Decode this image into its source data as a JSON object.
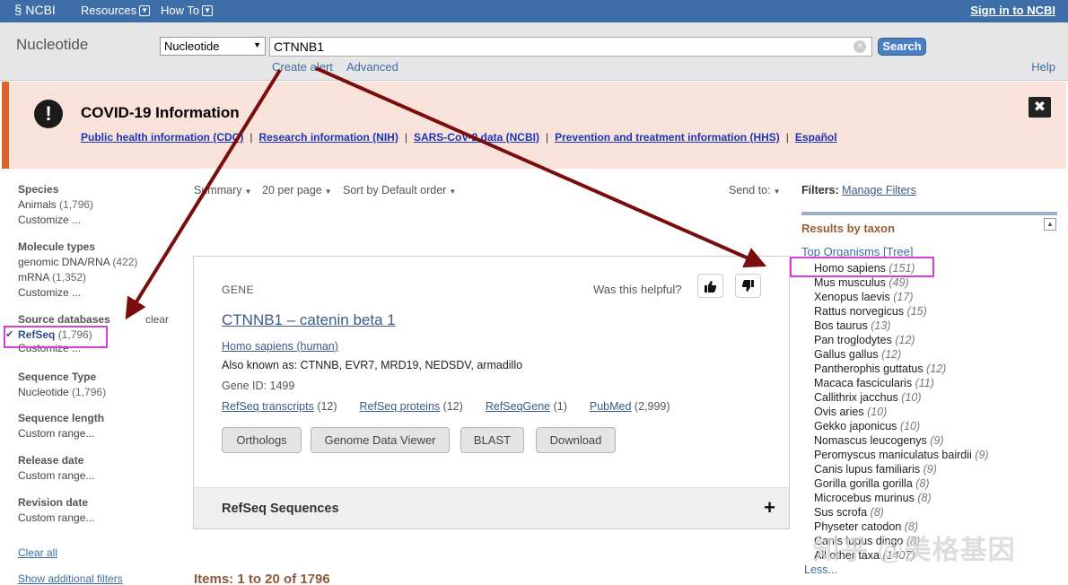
{
  "topbar": {
    "logo": "NCBI",
    "resources": "Resources",
    "howto": "How To",
    "signin": "Sign in to NCBI"
  },
  "search": {
    "db_title": "Nucleotide",
    "db_select": "Nucleotide",
    "term": "CTNNB1",
    "button": "Search",
    "create_alert": "Create alert",
    "advanced": "Advanced",
    "help": "Help"
  },
  "covid": {
    "title": "COVID-19 Information",
    "links": [
      "Public health information (CDC)",
      "Research information (NIH)",
      "SARS-CoV-2 data (NCBI)",
      "Prevention and treatment information (HHS)",
      "Español"
    ]
  },
  "facets": {
    "species": {
      "title": "Species",
      "items": [
        "Animals"
      ],
      "counts": [
        "(1,796)"
      ],
      "customize": "Customize ..."
    },
    "molecule": {
      "title": "Molecule types",
      "items": [
        "genomic DNA/RNA",
        "mRNA"
      ],
      "counts": [
        "(422)",
        "(1,352)"
      ],
      "customize": "Customize ..."
    },
    "source": {
      "title": "Source databases",
      "clear": "clear",
      "item": "RefSeq",
      "count": "(1,796)",
      "customize": "Customize ..."
    },
    "seqtype": {
      "title": "Sequence Type",
      "item": "Nucleotide",
      "count": "(1,796)"
    },
    "seqlen": {
      "title": "Sequence length",
      "item": "Custom range..."
    },
    "release": {
      "title": "Release date",
      "item": "Custom range..."
    },
    "revision": {
      "title": "Revision date",
      "item": "Custom range..."
    },
    "clear_all": "Clear all",
    "show_additional": "Show additional filters"
  },
  "toolbar": {
    "summary": "Summary",
    "per_page": "20 per page",
    "sort": "Sort by Default order",
    "send_to": "Send to:"
  },
  "gene": {
    "tag": "GENE",
    "helpful": "Was this helpful?",
    "title": "CTNNB1 – catenin beta 1",
    "organism": "Homo sapiens (human)",
    "aka": "Also known as: CTNNB, EVR7, MRD19, NEDSDV, armadillo",
    "gene_id": "Gene ID: 1499",
    "links": [
      {
        "label": "RefSeq transcripts",
        "count": "(12)"
      },
      {
        "label": "RefSeq proteins",
        "count": "(12)"
      },
      {
        "label": "RefSeqGene",
        "count": "(1)"
      },
      {
        "label": "PubMed",
        "count": "(2,999)"
      }
    ],
    "buttons": [
      "Orthologs",
      "Genome Data Viewer",
      "BLAST",
      "Download"
    ],
    "refseq_title": "RefSeq Sequences",
    "plus": "+"
  },
  "items_label": "Items: 1 to 20 of 1796",
  "filters": {
    "label": "Filters:",
    "manage": "Manage Filters",
    "results_by_taxon": "Results by taxon",
    "top_organisms": "Top Organisms  [Tree]",
    "less": "Less...",
    "taxa": [
      {
        "name": "Homo sapiens",
        "count": "(151)"
      },
      {
        "name": "Mus musculus",
        "count": "(49)"
      },
      {
        "name": "Xenopus laevis",
        "count": "(17)"
      },
      {
        "name": "Rattus norvegicus",
        "count": "(15)"
      },
      {
        "name": "Bos taurus",
        "count": "(13)"
      },
      {
        "name": "Pan troglodytes",
        "count": "(12)"
      },
      {
        "name": "Gallus gallus",
        "count": "(12)"
      },
      {
        "name": "Pantherophis guttatus",
        "count": "(12)"
      },
      {
        "name": "Macaca fascicularis",
        "count": "(11)"
      },
      {
        "name": "Callithrix jacchus",
        "count": "(10)"
      },
      {
        "name": "Ovis aries",
        "count": "(10)"
      },
      {
        "name": "Gekko japonicus",
        "count": "(10)"
      },
      {
        "name": "Nomascus leucogenys",
        "count": "(9)"
      },
      {
        "name": "Peromyscus maniculatus bairdii",
        "count": "(9)"
      },
      {
        "name": "Canis lupus familiaris",
        "count": "(9)"
      },
      {
        "name": "Gorilla gorilla gorilla",
        "count": "(8)"
      },
      {
        "name": "Microcebus murinus",
        "count": "(8)"
      },
      {
        "name": "Sus scrofa",
        "count": "(8)"
      },
      {
        "name": "Physeter catodon",
        "count": "(8)"
      },
      {
        "name": "Canis lupus dingo",
        "count": "(8)"
      },
      {
        "name": "All other taxa",
        "count": "(1407)"
      }
    ]
  },
  "watermark": "知乎 @美格基因",
  "colors": {
    "topbar": "#3e6ea8",
    "arrow": "#7a0c0c",
    "highlight": "#d63fd6",
    "covid_bg": "#f9e2d9",
    "covid_accent": "#d8642b"
  }
}
